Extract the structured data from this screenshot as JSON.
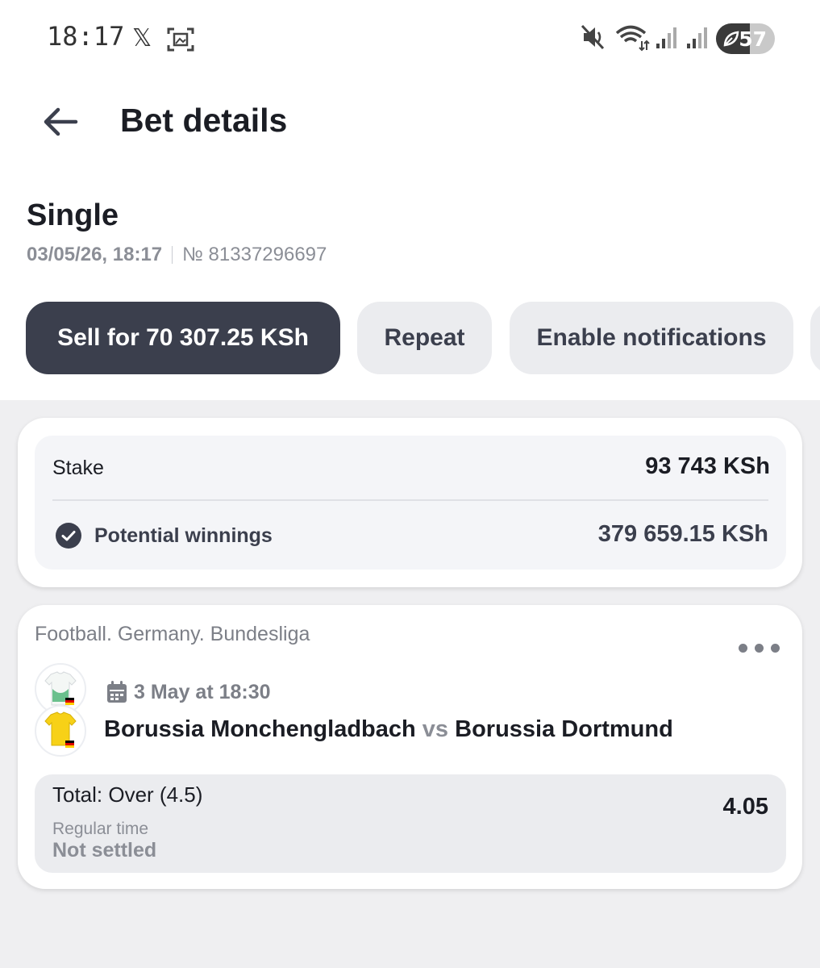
{
  "status_bar": {
    "time": "18:17",
    "x_glyph": "𝕏",
    "battery_level": "57",
    "battery_fraction": 0.57,
    "icons": [
      "x-logo-icon",
      "screenshot-icon",
      "mute-icon",
      "wifi-icon",
      "signal-icon",
      "signal-icon",
      "battery-saver-icon"
    ]
  },
  "header": {
    "title": "Bet details",
    "back_icon": "arrow-left-icon"
  },
  "bet": {
    "type": "Single",
    "date": "03/05/26, 18:17",
    "number": "№ 81337296697"
  },
  "actions": {
    "sell": "Sell for 70 307.25 KSh",
    "repeat": "Repeat",
    "notifications": "Enable notifications"
  },
  "summary": {
    "stake_label": "Stake",
    "stake_value": "93 743 KSh",
    "winnings_label": "Potential winnings",
    "winnings_value": "379 659.15 KSh",
    "winnings_icon": "check-circle-icon"
  },
  "event": {
    "league": "Football. Germany. Bundesliga",
    "date": "3 May at 18:30",
    "home": "Borussia Monchengladbach",
    "vs": "vs",
    "away": "Borussia Dortmund",
    "home_kit_color": "#ffffff",
    "away_kit_color": "#f7d117",
    "selection": {
      "market": "Total: Over (4.5)",
      "period": "Regular time",
      "status": "Not settled",
      "odds": "4.05"
    }
  },
  "colors": {
    "primary_dark": "#3b3f4d",
    "secondary_bg": "#ebecef",
    "page_bg": "#efeff1",
    "muted_text": "#8b8e96"
  }
}
